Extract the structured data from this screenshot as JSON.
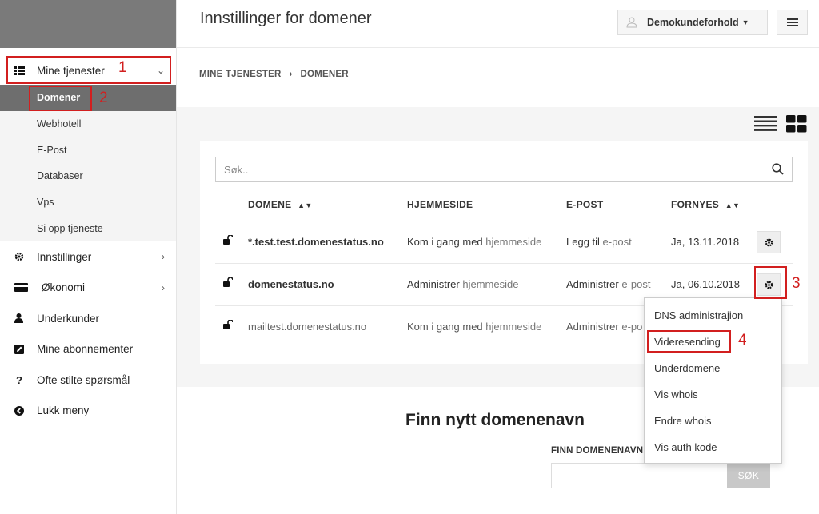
{
  "header": {
    "title": "Innstillinger for domener",
    "account_name": "Demokundeforhold"
  },
  "sidebar": {
    "main_item": "Mine tjenester",
    "sub_items": [
      "Domener",
      "Webhotell",
      "E-Post",
      "Databaser",
      "Vps",
      "Si opp tjeneste"
    ],
    "items": [
      "Innstillinger",
      "Økonomi",
      "Underkunder",
      "Mine abonnementer",
      "Ofte stilte spørsmål",
      "Lukk meny"
    ]
  },
  "breadcrumb": {
    "root": "MINE TJENESTER",
    "sep": "›",
    "current": "DOMENER"
  },
  "search": {
    "placeholder": "Søk.."
  },
  "table": {
    "headers": {
      "domain": "DOMENE",
      "website": "HJEMMESIDE",
      "email": "E-POST",
      "renew": "FORNYES"
    },
    "rows": [
      {
        "domain": "*.test.test.domenestatus.no",
        "web_action": "Kom i gang med",
        "web_suffix": "hjemmeside",
        "mail_action": "Legg til",
        "mail_suffix": "e-post",
        "renew": "Ja, 13.11.2018"
      },
      {
        "domain": "domenestatus.no",
        "web_action": "Administrer",
        "web_suffix": "hjemmeside",
        "mail_action": "Administrer",
        "mail_suffix": "e-post",
        "renew": "Ja, 06.10.2018"
      },
      {
        "domain": "mailtest.domenestatus.no",
        "web_action": "Kom i gang med",
        "web_suffix": "hjemmeside",
        "mail_action": "Administrer",
        "mail_suffix": "e-po"
      }
    ]
  },
  "dropdown": {
    "items": [
      "DNS administrajion",
      "Videresending",
      "Underdomene",
      "Vis whois",
      "Endre whois",
      "Vis auth kode"
    ]
  },
  "find": {
    "title": "Finn nytt domenenavn",
    "label": "FINN DOMENENAVN",
    "button": "SØK"
  },
  "annotations": [
    "1",
    "2",
    "3",
    "4"
  ],
  "colors": {
    "annotation": "#d21f1f",
    "active_sub": "#6e6e6e",
    "sidebar_top": "#7a7a7a"
  }
}
